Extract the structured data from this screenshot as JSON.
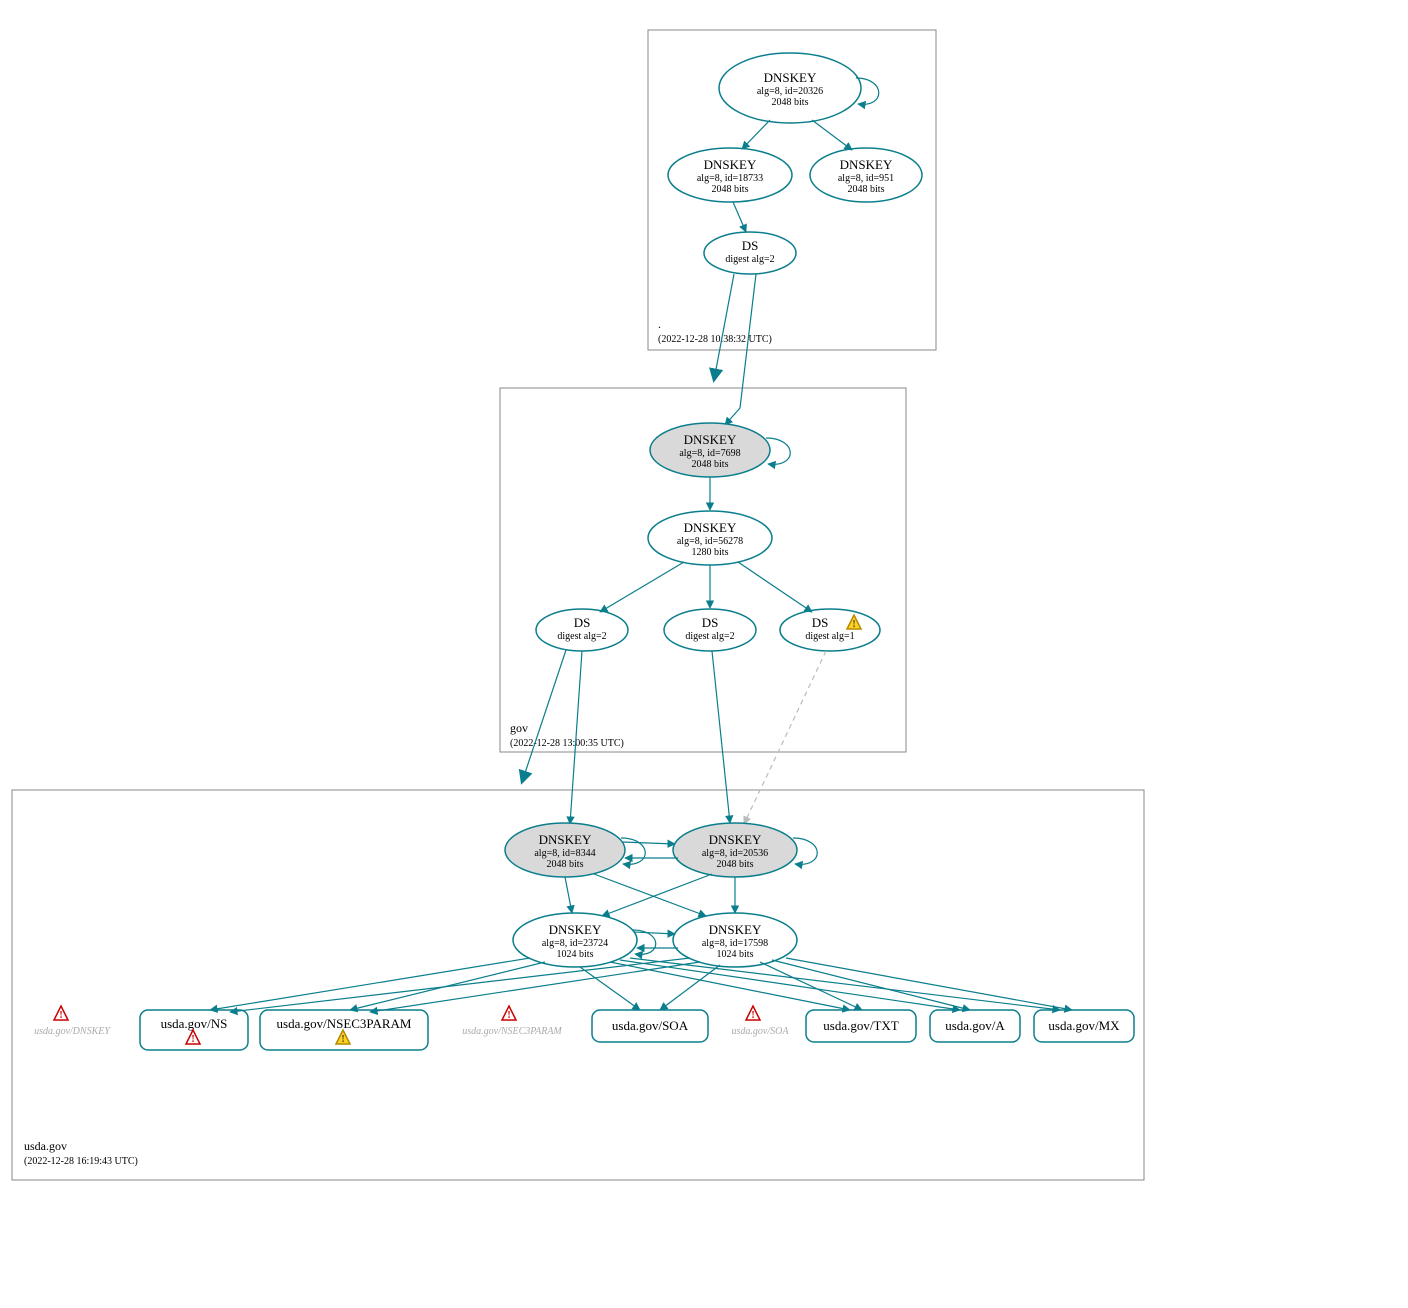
{
  "zones": {
    "root": {
      "label": ".",
      "time": "(2022-12-28 10:38:32 UTC)"
    },
    "gov": {
      "label": "gov",
      "time": "(2022-12-28 13:00:35 UTC)"
    },
    "usda": {
      "label": "usda.gov",
      "time": "(2022-12-28 16:19:43 UTC)"
    }
  },
  "nodes": {
    "root_ksk": {
      "t": "DNSKEY",
      "s1": "alg=8, id=20326",
      "s2": "2048 bits"
    },
    "root_zsk1": {
      "t": "DNSKEY",
      "s1": "alg=8, id=18733",
      "s2": "2048 bits"
    },
    "root_zsk2": {
      "t": "DNSKEY",
      "s1": "alg=8, id=951",
      "s2": "2048 bits"
    },
    "root_ds": {
      "t": "DS",
      "s1": "digest alg=2"
    },
    "gov_ksk": {
      "t": "DNSKEY",
      "s1": "alg=8, id=7698",
      "s2": "2048 bits"
    },
    "gov_zsk": {
      "t": "DNSKEY",
      "s1": "alg=8, id=56278",
      "s2": "1280 bits"
    },
    "gov_ds1": {
      "t": "DS",
      "s1": "digest alg=2"
    },
    "gov_ds2": {
      "t": "DS",
      "s1": "digest alg=2"
    },
    "gov_ds3": {
      "t": "DS",
      "s1": "digest alg=1"
    },
    "usda_ksk1": {
      "t": "DNSKEY",
      "s1": "alg=8, id=8344",
      "s2": "2048 bits"
    },
    "usda_ksk2": {
      "t": "DNSKEY",
      "s1": "alg=8, id=20536",
      "s2": "2048 bits"
    },
    "usda_zsk1": {
      "t": "DNSKEY",
      "s1": "alg=8, id=23724",
      "s2": "1024 bits"
    },
    "usda_zsk2": {
      "t": "DNSKEY",
      "s1": "alg=8, id=17598",
      "s2": "1024 bits"
    },
    "rr_ns": {
      "t": "usda.gov/NS"
    },
    "rr_n3p": {
      "t": "usda.gov/NSEC3PARAM"
    },
    "rr_soa": {
      "t": "usda.gov/SOA"
    },
    "rr_txt": {
      "t": "usda.gov/TXT"
    },
    "rr_a": {
      "t": "usda.gov/A"
    },
    "rr_mx": {
      "t": "usda.gov/MX"
    }
  },
  "ghosts": {
    "g_dnskey": "usda.gov/DNSKEY",
    "g_n3p": "usda.gov/NSEC3PARAM",
    "g_soa": "usda.gov/SOA"
  }
}
